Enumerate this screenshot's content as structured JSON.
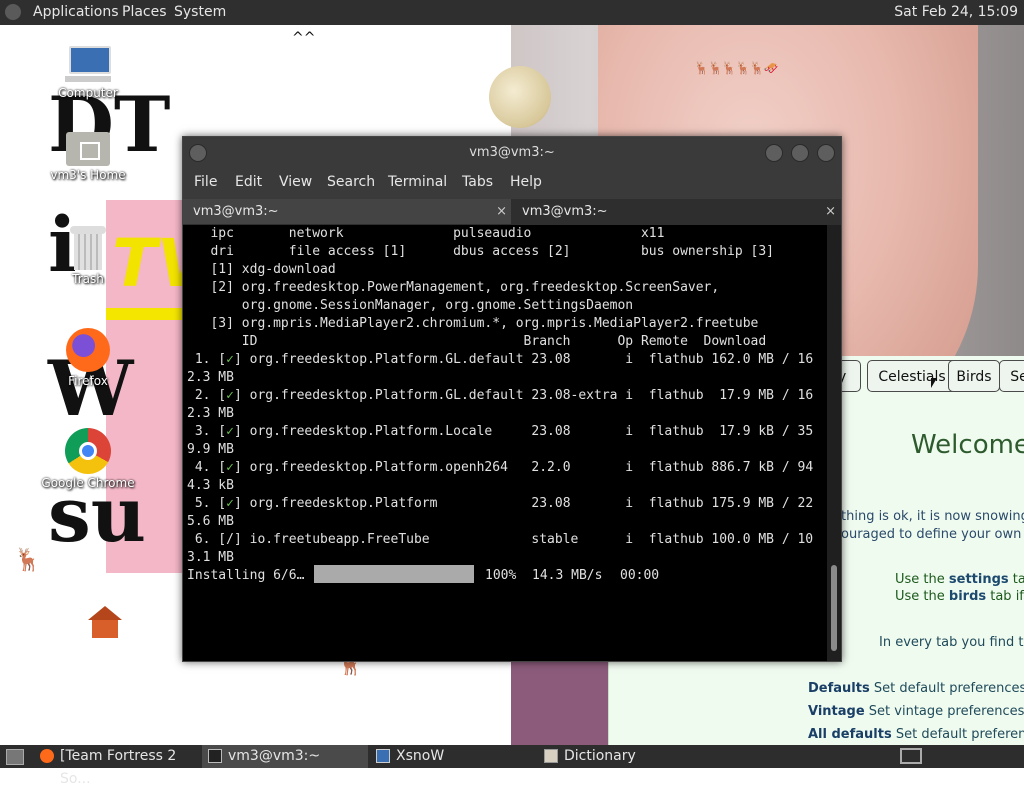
{
  "topbar": {
    "menus": [
      "Applications",
      "Places",
      "System"
    ],
    "clock": "Sat Feb 24, 15:09"
  },
  "desktop": {
    "icons": [
      {
        "label": "Computer",
        "icon": "computer-icon"
      },
      {
        "label": "vm3's Home",
        "icon": "home-folder-icon"
      },
      {
        "label": "Trash",
        "icon": "trash-icon"
      },
      {
        "label": "Firefox",
        "icon": "firefox-icon"
      },
      {
        "label": "Google Chrome",
        "icon": "chrome-icon"
      }
    ],
    "background_text": {
      "tv": "TV",
      "dt": "DT",
      "i": "i",
      "w": "W",
      "su": "su",
      "caret": "^^"
    }
  },
  "terminal": {
    "title": "vm3@vm3:~",
    "menu": [
      "File",
      "Edit",
      "View",
      "Search",
      "Terminal",
      "Tabs",
      "Help"
    ],
    "tabs": [
      {
        "label": "vm3@vm3:~",
        "close": "×"
      },
      {
        "label": "vm3@vm3:~",
        "close": "×"
      }
    ],
    "lines": [
      "   ipc       network              pulseaudio              x11",
      "   dri       file access [1]      dbus access [2]         bus ownership [3]",
      "",
      "   [1] xdg-download",
      "   [2] org.freedesktop.PowerManagement, org.freedesktop.ScreenSaver,",
      "       org.gnome.SessionManager, org.gnome.SettingsDaemon",
      "   [3] org.mpris.MediaPlayer2.chromium.*, org.mpris.MediaPlayer2.freetube",
      "",
      "",
      "       ID                                  Branch      Op Remote  Download",
      " 1. [✓] org.freedesktop.Platform.GL.default 23.08       i  flathub 162.0 MB / 16",
      "2.3 MB",
      " 2. [✓] org.freedesktop.Platform.GL.default 23.08-extra i  flathub  17.9 MB / 16",
      "2.3 MB",
      " 3. [✓] org.freedesktop.Platform.Locale     23.08       i  flathub  17.9 kB / 35",
      "9.9 MB",
      " 4. [✓] org.freedesktop.Platform.openh264   2.2.0       i  flathub 886.7 kB / 94",
      "4.3 kB",
      " 5. [✓] org.freedesktop.Platform            23.08       i  flathub 175.9 MB / 22",
      "5.6 MB",
      " 6. [/] io.freetubeapp.FreeTube             stable      i  flathub 100.0 MB / 10",
      "3.1 MB",
      ""
    ],
    "progress": {
      "prefix": "Installing 6/6…",
      "percent_text": "100%",
      "speed": "14.3 MB/s",
      "eta": "00:00",
      "fraction": 1.0
    }
  },
  "xsnow": {
    "tabs": [
      "ery",
      "Celestials",
      "Birds",
      "Se"
    ],
    "welcome": "Welcome",
    "text1": "thing is ok, it is now snowing or",
    "text2": "ouraged to define your own pre",
    "settings_line": {
      "prefix": "Use the ",
      "bold": "settings",
      "suffix": " tab if"
    },
    "birds_line": {
      "prefix": "Use the ",
      "bold": "birds",
      "suffix": " tab if bir"
    },
    "every_tab": "In every tab you find the",
    "defaults": [
      {
        "label": "Defaults",
        "desc": "Set default preferences fo"
      },
      {
        "label": "Vintage",
        "desc": "Set vintage preferences for"
      },
      {
        "label": "All defaults",
        "desc": "Set default preferences for"
      }
    ]
  },
  "taskbar": {
    "tasks": [
      {
        "label": "[Team Fortress 2 So...",
        "icon": "firefox-icon"
      },
      {
        "label": "vm3@vm3:~",
        "icon": "terminal-icon",
        "active": true
      },
      {
        "label": "XsnoW",
        "icon": "window-icon"
      },
      {
        "label": "Dictionary",
        "icon": "dictionary-icon"
      }
    ]
  }
}
